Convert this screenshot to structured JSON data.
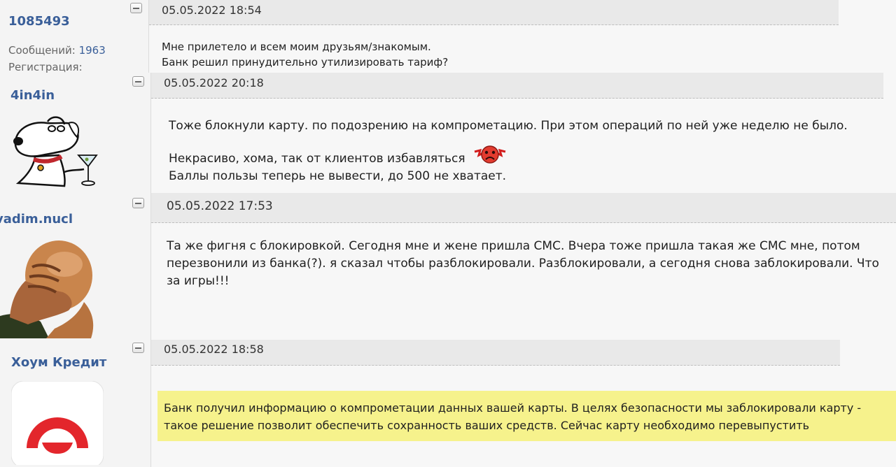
{
  "posts": [
    {
      "username": "1085493",
      "messages_label": "Сообщений:",
      "messages_count": "1963",
      "registration_label": "Регистрация:",
      "date": "05.05.2022 18:54",
      "lines": [
        "Мне прилетело и всем моим друзьям/знакомым.",
        "Банк решил принудительно утилизировать тариф?"
      ]
    },
    {
      "username": "4in4in",
      "date": "05.05.2022 20:18",
      "line1": "Тоже блокнули карту. по подозрению на компрометацию. При этом операций по ней уже неделю не было.",
      "line2": "Некрасиво, хома, так от клиентов избавляться",
      "line3": "Баллы пользы теперь не вывести, до 500 не хватает."
    },
    {
      "username": "vadim.nucl",
      "date": "05.05.2022 17:53",
      "text": "Та же фигня с блокировкой. Сегодня мне и жене пришла СМС. Вчера тоже пришла такая же СМС мне, потом перезвонили из банка(?). я сказал чтобы разблокировали. Разблокировали, а сегодня снова заблокировали. Что за игры!!!"
    },
    {
      "username": "Хоум Кредит",
      "date": "05.05.2022 18:58",
      "text": "Банк получил информацию о компрометации данных вашей карты. В целях безопасности мы заблокировали карту - такое решение позволит обеспечить сохранность ваших средств. Сейчас карту необходимо перевыпустить"
    }
  ],
  "colors": {
    "username": "#3a5f99",
    "highlight": "#f6f28c",
    "logo_red": "#e3262c"
  },
  "icons": {
    "collapse": "minus-icon",
    "smiley": "angry-smiley-icon"
  }
}
